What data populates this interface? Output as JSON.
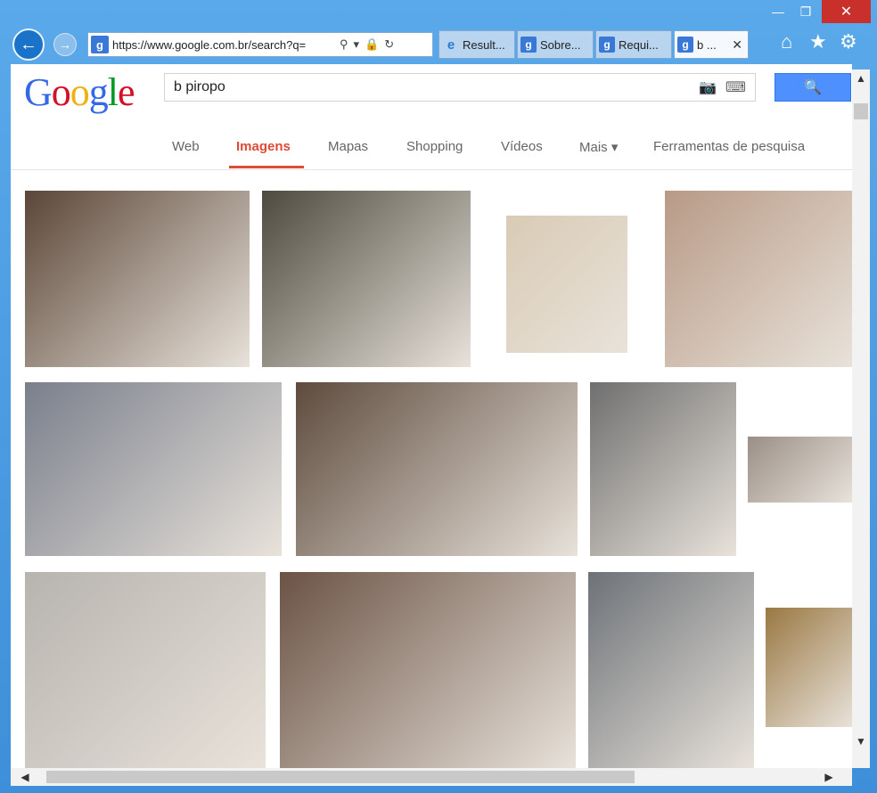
{
  "window": {
    "controls": {
      "minimize": "—",
      "maximize": "❐",
      "close": "✕"
    }
  },
  "nav": {
    "back_icon": "←",
    "forward_icon": "→",
    "address": {
      "favicon": "g",
      "url": "https://www.google.com.br/search?q=",
      "icons": {
        "search": "⚲",
        "dropdown": "▾",
        "lock": "🔒",
        "refresh": "↻"
      }
    }
  },
  "tabs": [
    {
      "label": "Result...",
      "favicon": "e",
      "active": false
    },
    {
      "label": "Sobre...",
      "favicon": "g",
      "active": false
    },
    {
      "label": "Requi...",
      "favicon": "g",
      "active": false
    },
    {
      "label": "b ...",
      "favicon": "g",
      "active": true,
      "close": "✕"
    }
  ],
  "right_icons": {
    "home": "⌂",
    "favorites": "★",
    "tools": "⚙"
  },
  "google": {
    "logo": {
      "letters": [
        "G",
        "o",
        "o",
        "g",
        "l",
        "e"
      ],
      "colors": [
        "#3369e8",
        "#d50f25",
        "#eeb211",
        "#3369e8",
        "#009925",
        "#d50f25"
      ]
    },
    "query": "b piropo",
    "search_button_icon": "🔍",
    "camera_icon": "📷",
    "keyboard_icon": "⌨"
  },
  "menu": {
    "items": [
      "Web",
      "Imagens",
      "Mapas",
      "Shopping",
      "Vídeos",
      "Mais ▾",
      "Ferramentas de pesquisa"
    ],
    "active": "Imagens"
  },
  "results": {
    "thumbnails": [
      {
        "color": "#5b4638"
      },
      {
        "color": "#4e4a3f"
      },
      {
        "color": "#d9cbb5"
      },
      {
        "color": "#b89a86"
      },
      {
        "color": "#7a7f8c"
      },
      {
        "color": "#5e4b3e"
      },
      {
        "color": "#6f6f6f"
      },
      {
        "color": "#9a8f86"
      },
      {
        "color": "#b7b3ae"
      },
      {
        "color": "#6b5345"
      },
      {
        "color": "#6d7278"
      },
      {
        "color": "#9a7843"
      }
    ]
  },
  "scrollbars": {
    "up": "▲",
    "down": "▼",
    "left": "◀",
    "right": "▶"
  }
}
